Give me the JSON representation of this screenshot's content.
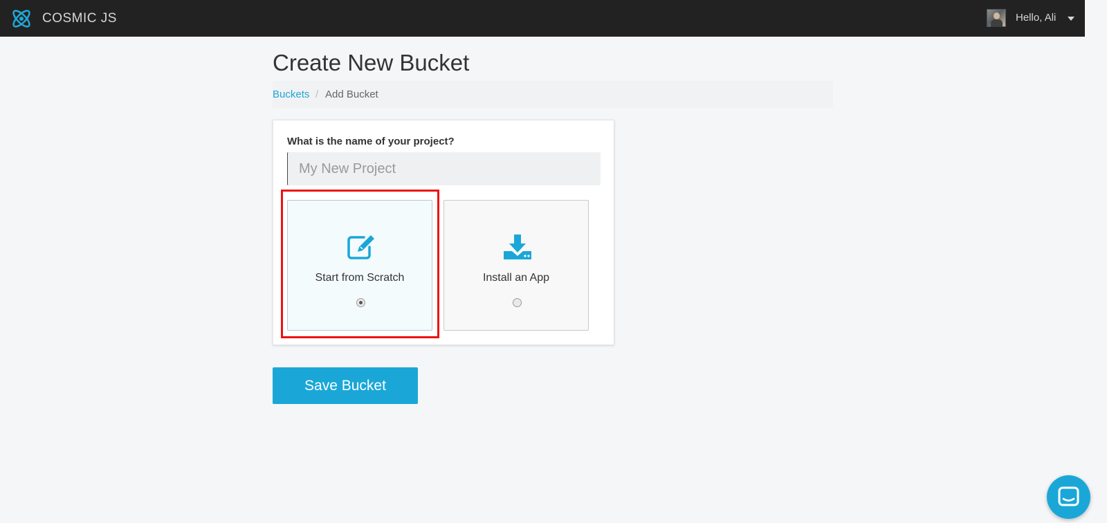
{
  "header": {
    "brand": "COSMIC JS",
    "greeting": "Hello, Ali"
  },
  "page": {
    "title": "Create New Bucket"
  },
  "breadcrumb": {
    "link": "Buckets",
    "separator": "/",
    "current": "Add Bucket"
  },
  "form": {
    "name_label": "What is the name of your project?",
    "name_value": "",
    "name_placeholder": "My New Project",
    "options": [
      {
        "label": "Start from Scratch",
        "icon": "edit-icon",
        "selected": true
      },
      {
        "label": "Install an App",
        "icon": "download-icon",
        "selected": false
      }
    ],
    "save_label": "Save Bucket"
  },
  "colors": {
    "accent": "#1aa7d8",
    "topbar": "#222222",
    "highlight": "#ee1111"
  }
}
